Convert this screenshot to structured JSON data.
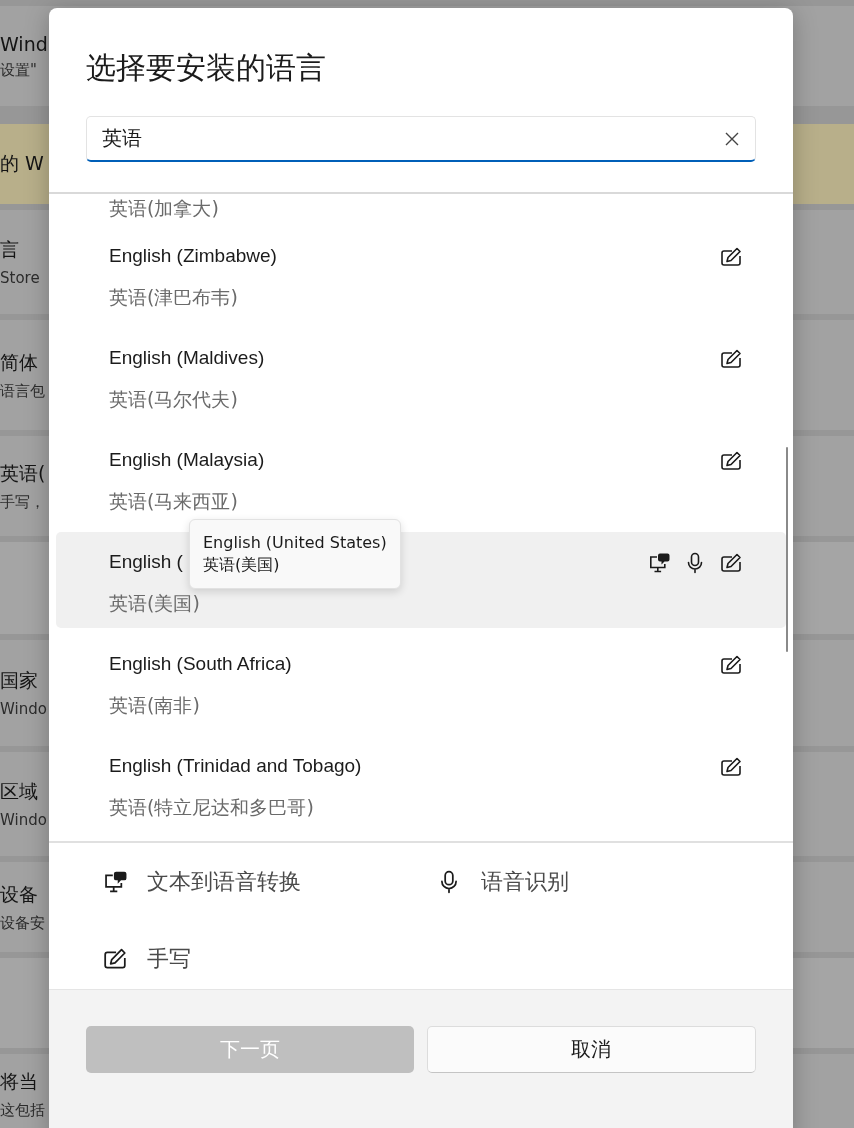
{
  "background_page": {
    "rows": [
      {
        "kind": "card",
        "title": "Wind",
        "subtitle": "设置\""
      },
      {
        "kind": "banner",
        "title": "的 W"
      },
      {
        "kind": "card",
        "title": "言",
        "subtitle": "Store"
      },
      {
        "kind": "card",
        "title": "简体",
        "subtitle": "语言包"
      },
      {
        "kind": "card",
        "title": "英语(",
        "subtitle": "手写，"
      },
      {
        "kind": "blank"
      },
      {
        "kind": "card",
        "title": "国家",
        "subtitle": "Windo"
      },
      {
        "kind": "card",
        "title": "区域",
        "subtitle": "Windo"
      },
      {
        "kind": "card",
        "title": "设备",
        "subtitle": "设备安"
      },
      {
        "kind": "blank"
      },
      {
        "kind": "card",
        "title": "将当",
        "subtitle": "这包括"
      }
    ]
  },
  "dialog": {
    "title": "选择要安装的语言",
    "search": {
      "value": "英语"
    },
    "partial_item": {
      "native": "英语(加拿大)"
    },
    "languages": [
      {
        "name": "English (Zimbabwe)",
        "native": "英语(津巴布韦)",
        "features": [
          {
            "kind": "handwriting"
          }
        ],
        "hovered": false
      },
      {
        "name": "English (Maldives)",
        "native": "英语(马尔代夫)",
        "features": [
          {
            "kind": "handwriting"
          }
        ],
        "hovered": false
      },
      {
        "name": "English (Malaysia)",
        "native": "英语(马来西亚)",
        "features": [
          {
            "kind": "handwriting"
          }
        ],
        "hovered": false
      },
      {
        "name": "English (",
        "native": "英语(美国)",
        "features": [
          {
            "kind": "tts"
          },
          {
            "kind": "speech"
          },
          {
            "kind": "handwriting"
          }
        ],
        "hovered": true
      },
      {
        "name": "English (South Africa)",
        "native": "英语(南非)",
        "features": [
          {
            "kind": "handwriting"
          }
        ],
        "hovered": false
      },
      {
        "name": "English (Trinidad and Tobago)",
        "native": "英语(特立尼达和多巴哥)",
        "features": [
          {
            "kind": "handwriting"
          }
        ],
        "hovered": false
      }
    ],
    "tooltip": {
      "lines": [
        "English (United States)",
        "英语(美国)"
      ]
    },
    "legend": [
      {
        "kind": "tts",
        "label": "文本到语音转换"
      },
      {
        "kind": "speech",
        "label": "语音识别"
      },
      {
        "kind": "handwriting",
        "label": "手写"
      }
    ],
    "buttons": [
      {
        "label": "下一页",
        "disabled": true
      },
      {
        "label": "取消",
        "disabled": false
      }
    ]
  }
}
